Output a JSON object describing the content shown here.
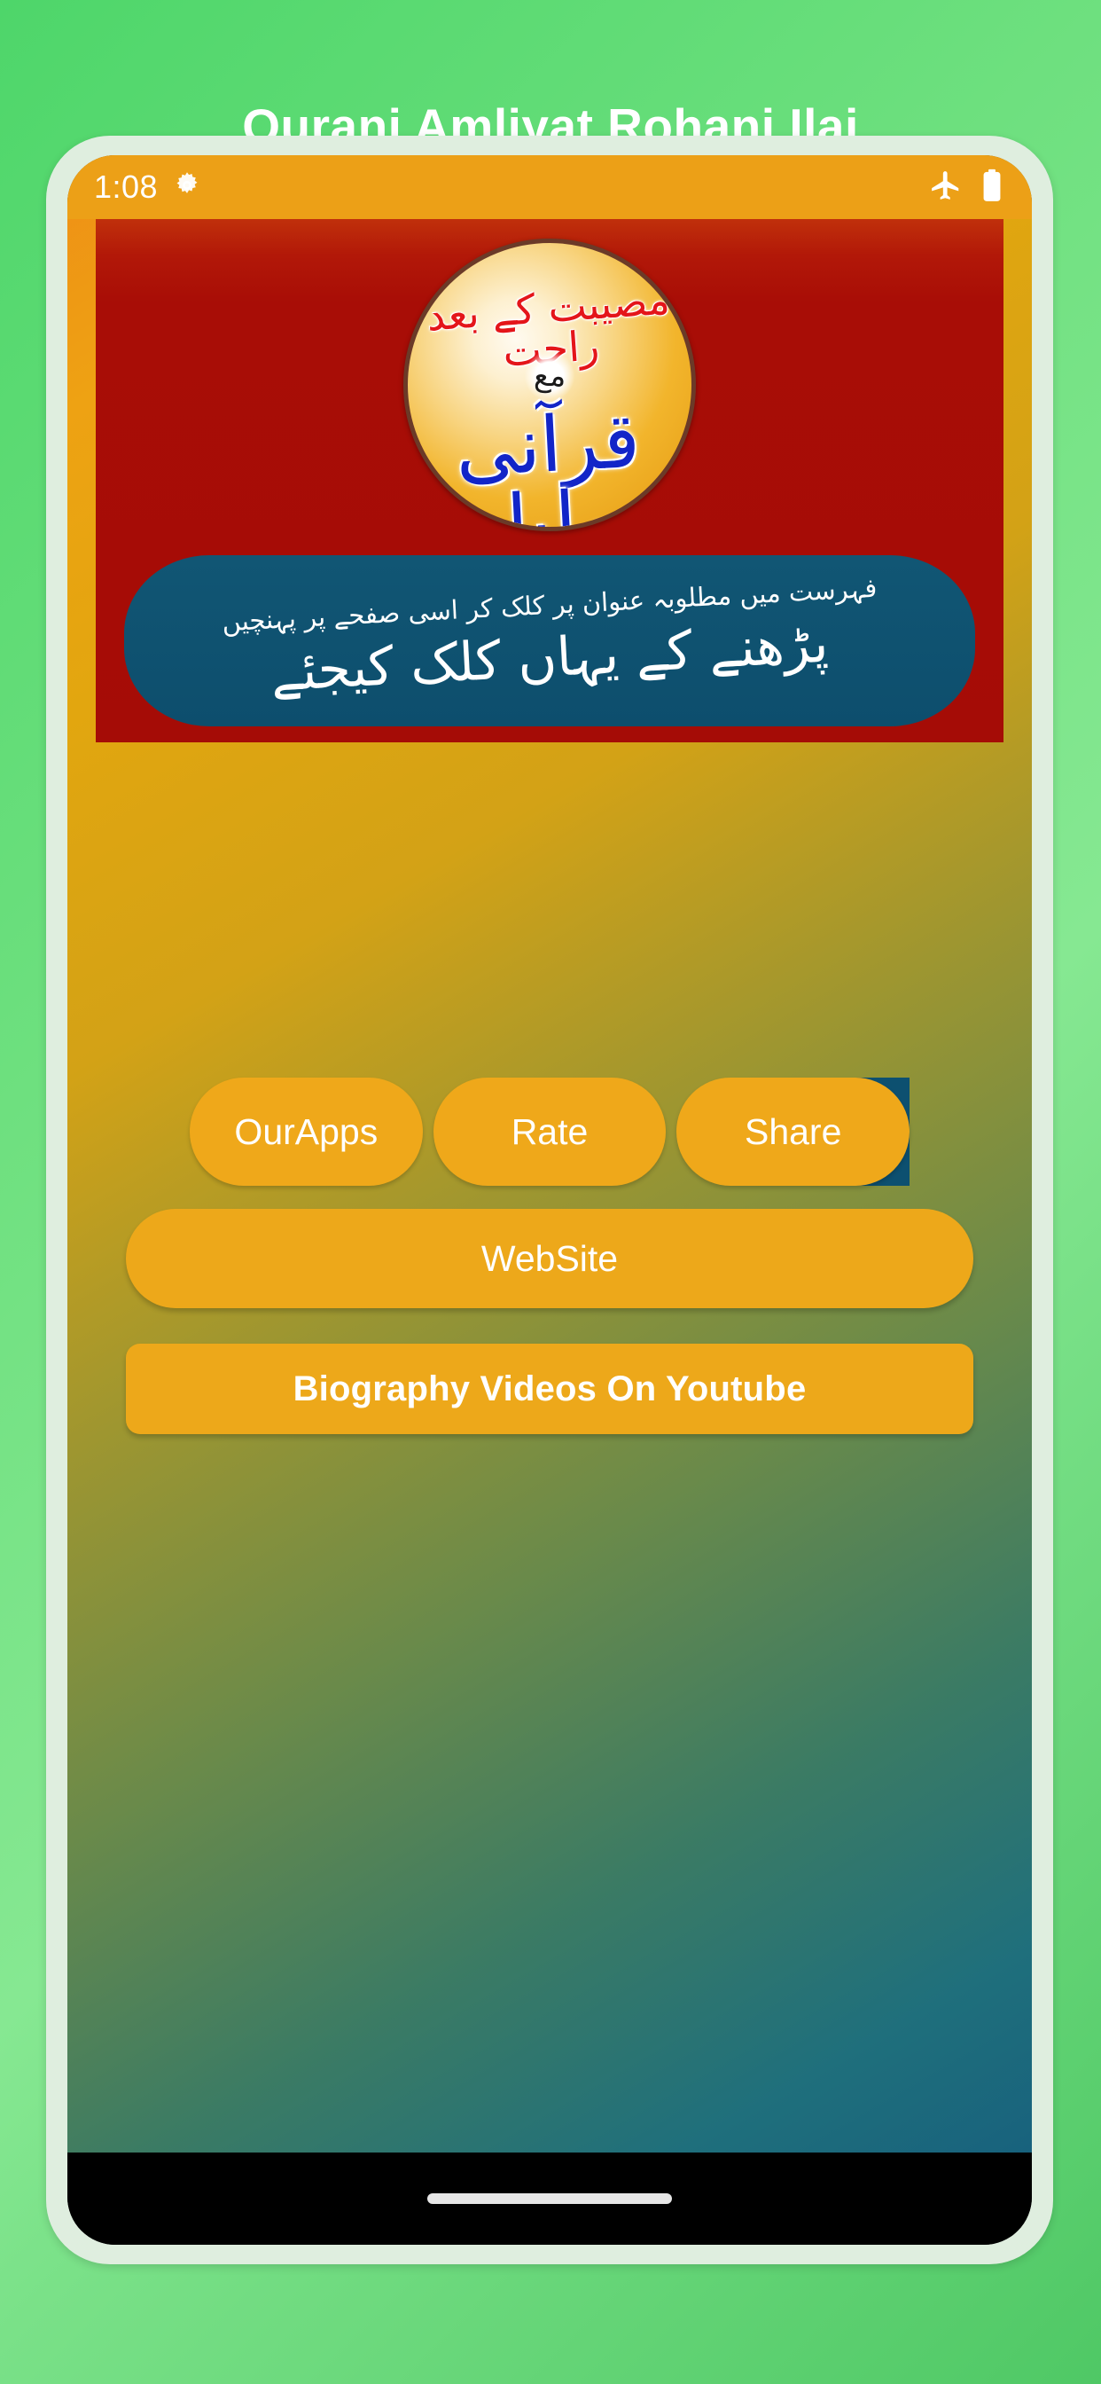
{
  "page": {
    "title": "Qurani Amliyat Rohani Ilaj"
  },
  "status_bar": {
    "time": "1:08",
    "icons": {
      "settings": "gear-icon",
      "airplane": "airplane-mode-icon",
      "battery": "battery-full-icon"
    }
  },
  "banner": {
    "logo": {
      "top_line": "مصیبت کے بعد راحت",
      "middle": "مع",
      "bottom_line": "قرآنی عملیات"
    },
    "instruction": {
      "line1": "فہرست میں مطلوبہ عنوان پر کلک کر اسی صفحے پر پہنچیں",
      "line2": "پڑھنے کے یہاں کلک کیجئے"
    }
  },
  "buttons": {
    "our_apps": "OurApps",
    "rate": "Rate",
    "share": "Share",
    "website": "WebSite",
    "biography": "Biography Videos On Youtube"
  },
  "colors": {
    "page_background_green": "#6ee07f",
    "phone_bezel": "#dfeedf",
    "status_bar_orange": "#eca017",
    "banner_red": "#a80d06",
    "panel_blue": "#0d5070",
    "button_orange": "#eda81a",
    "logo_red_text": "#e4151a",
    "logo_blue_text": "#1225c8",
    "nav_bar_black": "#000000"
  }
}
